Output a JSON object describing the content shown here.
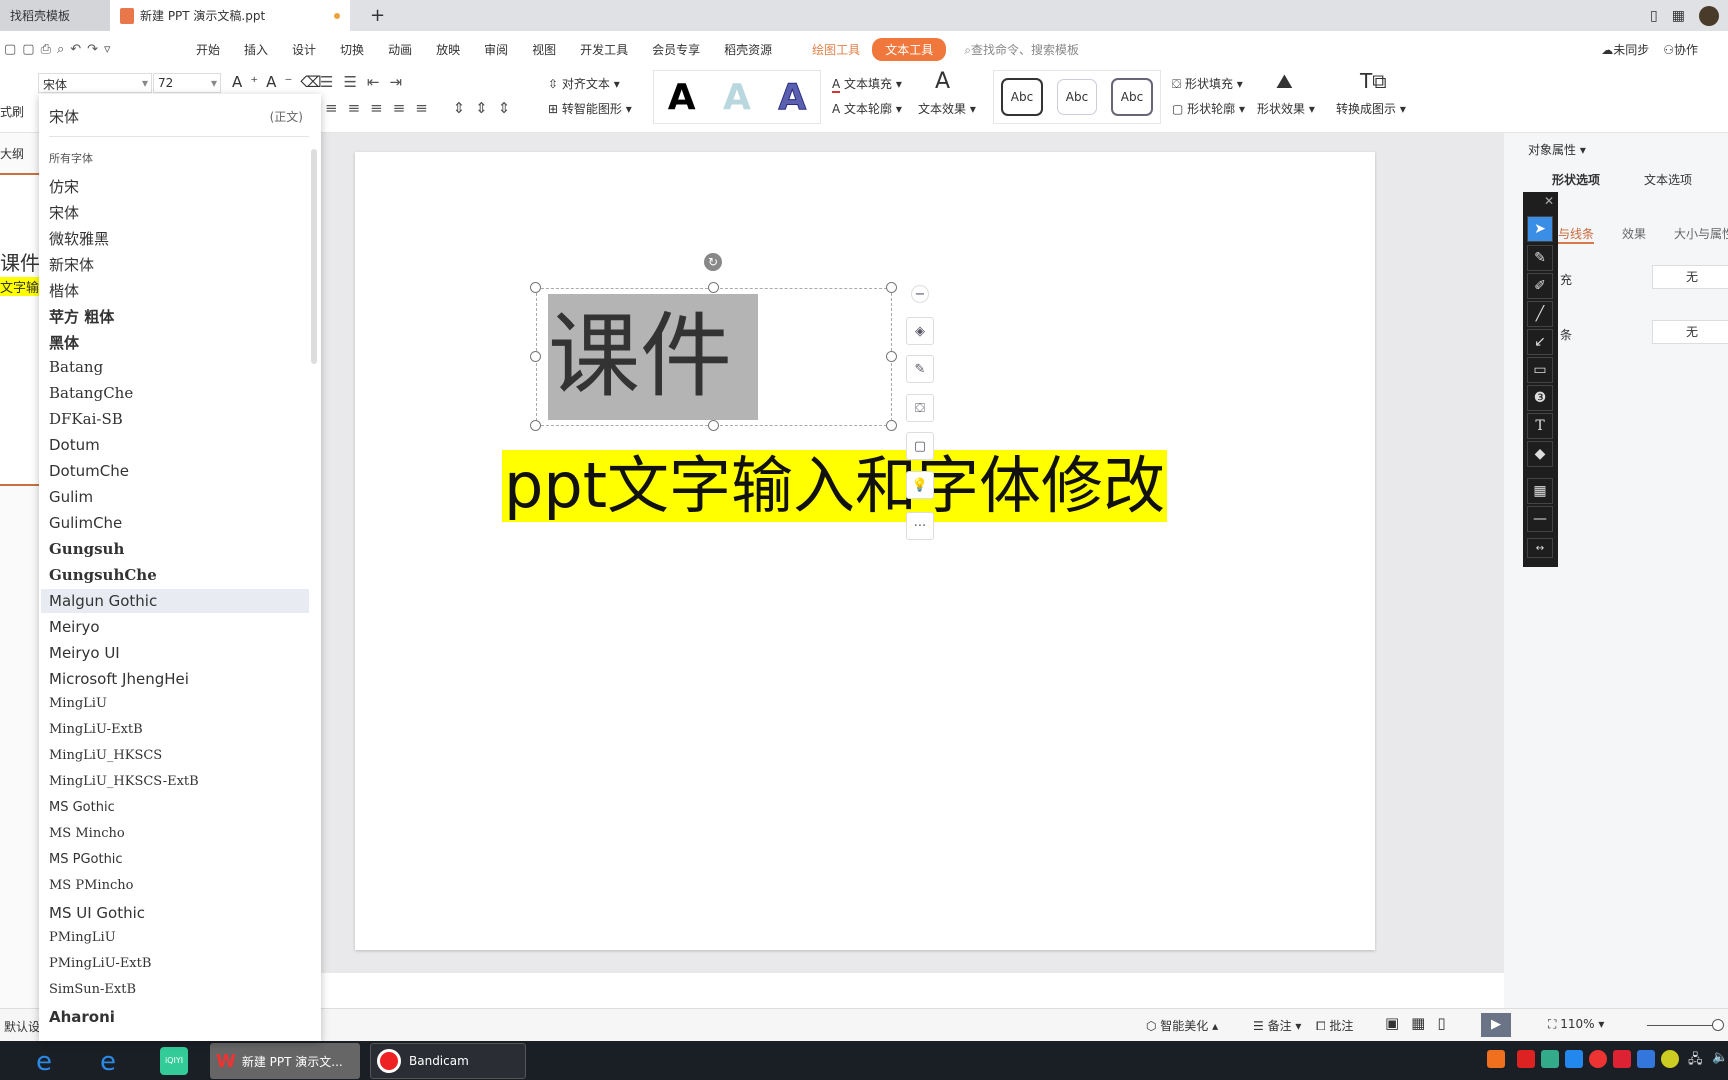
{
  "tabs": [
    {
      "label": "找稻壳模板"
    },
    {
      "label": "新建 PPT 演示文稿.ppt"
    }
  ],
  "menu": [
    "开始",
    "插入",
    "设计",
    "切换",
    "动画",
    "放映",
    "审阅",
    "视图",
    "开发工具",
    "会员专享",
    "稻壳资源",
    "绘图工具",
    "文本工具"
  ],
  "search_placeholder": "查找命令、搜索模板",
  "header_right": {
    "sync": "未同步",
    "collab": "协作"
  },
  "toolbar": {
    "font_name": "宋体",
    "font_size": "72",
    "format_painter": "式刷",
    "align_text": "对齐文本",
    "smart_shape": "转智能图形",
    "text_fill": "文本填充",
    "text_outline": "文本轮廓",
    "text_effect": "文本效果",
    "shape_fill": "形状填充",
    "shape_outline": "形状轮廓",
    "shape_effect": "形状效果",
    "convert": "转换成图示",
    "wordart": [
      "A",
      "A",
      "A"
    ],
    "style_sample": "Abc"
  },
  "font_dropdown": {
    "recent": {
      "name": "宋体",
      "tag": "(正文)"
    },
    "section": "所有字体",
    "fonts": [
      "仿宋",
      "宋体",
      "微软雅黑",
      "新宋体",
      "楷体",
      "苹方 粗体",
      "黑体",
      "Batang",
      "BatangChe",
      "DFKai-SB",
      "Dotum",
      "DotumChe",
      "Gulim",
      "GulimChe",
      "Gungsuh",
      "GungsuhChe",
      "Malgun Gothic",
      "Meiryo",
      "Meiryo UI",
      "Microsoft JhengHei",
      "MingLiU",
      "MingLiU-ExtB",
      "MingLiU_HKSCS",
      "MingLiU_HKSCS-ExtB",
      "MS Gothic",
      "MS Mincho",
      "MS PGothic",
      "MS PMincho",
      "MS UI Gothic",
      "PMingLiU",
      "PMingLiU-ExtB",
      "SimSun-ExtB",
      "Aharoni"
    ],
    "highlighted": "Malgun Gothic"
  },
  "left_panel": {
    "outline_tab": "大纲",
    "thumb_title": "课件",
    "thumb_subtitle": "文字输"
  },
  "slide": {
    "title": "课件",
    "subtitle": "ppt文字输入和字体修改",
    "highlight_color": "#ffff00"
  },
  "right_panel": {
    "title": "对象属性",
    "tabs": [
      "形状选项",
      "文本选项"
    ],
    "subtabs": [
      "与线条",
      "效果",
      "大小与属性"
    ],
    "fill_label": "充",
    "fill_value": "无",
    "line_label": "条",
    "line_value": "无"
  },
  "statusbar": {
    "left": "默认设",
    "beautify": "智能美化",
    "notes": "备注",
    "comment": "批注",
    "zoom": "110%"
  },
  "taskbar": {
    "wps": "新建 PPT 演示文...",
    "bandicam": "Bandicam"
  },
  "accent": "#f0783c"
}
